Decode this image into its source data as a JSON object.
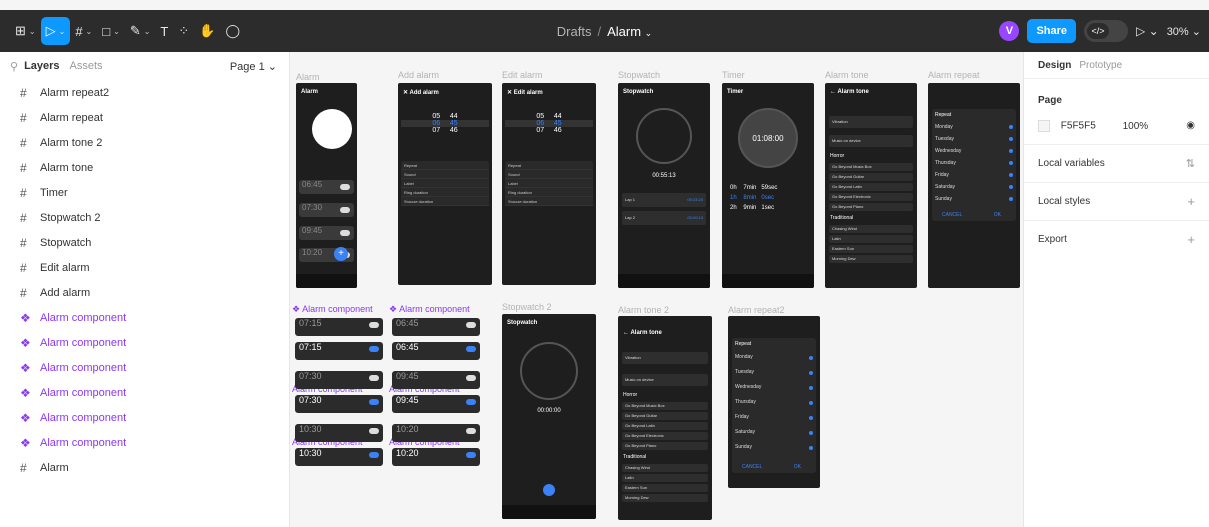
{
  "toolbar": {
    "menu_icon": "figma-menu-icon",
    "tools": [
      "move-tool",
      "frame-tool",
      "shape-tool",
      "pen-tool",
      "text-tool",
      "resources-tool",
      "hand-tool",
      "comment-tool"
    ],
    "text_glyph": "T",
    "breadcrumb_folder": "Drafts",
    "breadcrumb_sep": "/",
    "file_name": "Alarm",
    "avatar_letter": "V",
    "avatar_color": "#9747ff",
    "share_label": "Share",
    "dev_toggle": "</>",
    "zoom": "30%"
  },
  "layers_panel": {
    "tab_layers": "Layers",
    "tab_assets": "Assets",
    "page_label": "Page 1",
    "items": [
      {
        "label": "Alarm repeat2",
        "type": "frame"
      },
      {
        "label": "Alarm repeat",
        "type": "frame"
      },
      {
        "label": "Alarm tone 2",
        "type": "frame"
      },
      {
        "label": "Alarm tone",
        "type": "frame"
      },
      {
        "label": "Timer",
        "type": "frame"
      },
      {
        "label": "Stopwatch 2",
        "type": "frame"
      },
      {
        "label": "Stopwatch",
        "type": "frame"
      },
      {
        "label": "Edit alarm",
        "type": "frame"
      },
      {
        "label": "Add alarm",
        "type": "frame"
      },
      {
        "label": "Alarm component",
        "type": "component"
      },
      {
        "label": "Alarm component",
        "type": "component"
      },
      {
        "label": "Alarm component",
        "type": "component"
      },
      {
        "label": "Alarm component",
        "type": "component"
      },
      {
        "label": "Alarm component",
        "type": "component"
      },
      {
        "label": "Alarm component",
        "type": "component"
      },
      {
        "label": "Alarm",
        "type": "frame"
      }
    ]
  },
  "canvas": {
    "frame_labels": {
      "alarm": "Alarm",
      "add_alarm": "Add alarm",
      "edit_alarm": "Edit alarm",
      "stopwatch": "Stopwatch",
      "timer": "Timer",
      "alarm_tone": "Alarm tone",
      "alarm_repeat": "Alarm repeat",
      "stopwatch2": "Stopwatch 2",
      "alarm_tone2": "Alarm tone 2",
      "alarm_repeat2": "Alarm repeat2",
      "component": "Alarm component"
    },
    "alarm_screen": {
      "header": "Alarm",
      "times": [
        "06:45",
        "07:30",
        "09:45",
        "10:20"
      ]
    },
    "add_alarm": {
      "header": "Add alarm",
      "picker": [
        [
          "05",
          "44"
        ],
        [
          "06",
          "45"
        ],
        [
          "07",
          "46"
        ]
      ],
      "settings": [
        "Repeat",
        "Sound",
        "Label",
        "Ring duration",
        "Snooze duration"
      ]
    },
    "edit_alarm": {
      "header": "Edit alarm",
      "picker": [
        [
          "05",
          "44"
        ],
        [
          "06",
          "45"
        ],
        [
          "07",
          "46"
        ]
      ],
      "settings": [
        "Repeat",
        "Sound",
        "Label",
        "Ring duration",
        "Snooze duration"
      ]
    },
    "stopwatch": {
      "header": "Stopwatch",
      "time": "00:55:13",
      "laps": [
        "Lap 1",
        "Lap 2"
      ],
      "lap_times": [
        "00:23:23",
        "00:00:13"
      ]
    },
    "timer": {
      "header": "Timer",
      "time": "01:08:00",
      "rows": [
        [
          "0h",
          "7min",
          "59sec"
        ],
        [
          "1h",
          "8min",
          "0sec"
        ],
        [
          "2h",
          "9min",
          "1sec"
        ]
      ]
    },
    "alarm_tone": {
      "header": "Alarm tone",
      "vibration": "Vibration",
      "music": "Music on device",
      "section1": "Horror",
      "horror": [
        "Go Beyond Music Box",
        "Go Beyond Guitar",
        "Go Beyond Latin",
        "Go Beyond Electronic",
        "Go Beyond Piano"
      ],
      "section2": "Traditional",
      "traditional": [
        "Chasing Wind",
        "Latin",
        "Eastern Sun",
        "Morning Dew"
      ]
    },
    "alarm_repeat": {
      "header": "Repeat",
      "days": [
        "Monday",
        "Tuesday",
        "Wednesday",
        "Thursday",
        "Friday",
        "Saturday",
        "Sunday"
      ],
      "cancel": "CANCEL",
      "ok": "OK"
    },
    "stopwatch2": {
      "header": "Stopwatch",
      "time": "00:00:00"
    },
    "components": {
      "left": [
        "07:15",
        "07:15",
        "07:30",
        "07:30",
        "10:30",
        "10:30"
      ],
      "right": [
        "06:45",
        "06:45",
        "09:45",
        "09:45",
        "10:20",
        "10:20"
      ]
    }
  },
  "design_panel": {
    "tab_design": "Design",
    "tab_prototype": "Prototype",
    "page_title": "Page",
    "page_color": "F5F5F5",
    "page_opacity": "100%",
    "local_variables": "Local variables",
    "local_styles": "Local styles",
    "export": "Export"
  }
}
